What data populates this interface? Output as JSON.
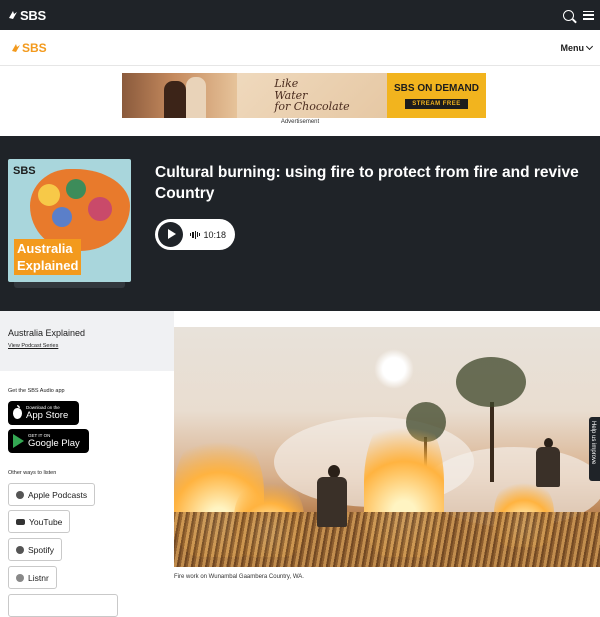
{
  "topbar": {
    "logo_text": "SBS",
    "search_icon": "search-icon",
    "menu_icon": "hamburger-icon"
  },
  "navbar": {
    "logo_text": "SBS",
    "menu_label": "Menu"
  },
  "ad": {
    "script_line1": "Like",
    "script_line2": "Water",
    "script_line3": "for Chocolate",
    "brand": "SBS ON DEMAND",
    "cta": "STREAM FREE",
    "label": "Advertisement"
  },
  "hero": {
    "cover": {
      "logo": "SBS",
      "title_line1": "Australia",
      "title_line2": "Explained"
    },
    "title": "Cultural burning: using fire to protect from fire and revive Country",
    "duration": "10:18"
  },
  "sidebar": {
    "series_name": "Australia Explained",
    "series_link": "View Podcast Series",
    "get_app": "Get the SBS Audio app",
    "app_store_small": "Download on the",
    "app_store_big": "App Store",
    "google_small": "GET IT ON",
    "google_big": "Google Play",
    "other_ways": "Other ways to listen",
    "listen_options": [
      "Apple Podcasts",
      "YouTube",
      "Spotify",
      "Listnr"
    ]
  },
  "photo": {
    "caption": "Fire work on Wunambal Gaambera Country, WA."
  },
  "side_tab": {
    "label": "Help us improve"
  },
  "colors": {
    "dark": "#1f2328",
    "sbs_orange": "#f39a1d",
    "ad_yellow": "#f2b41e"
  }
}
